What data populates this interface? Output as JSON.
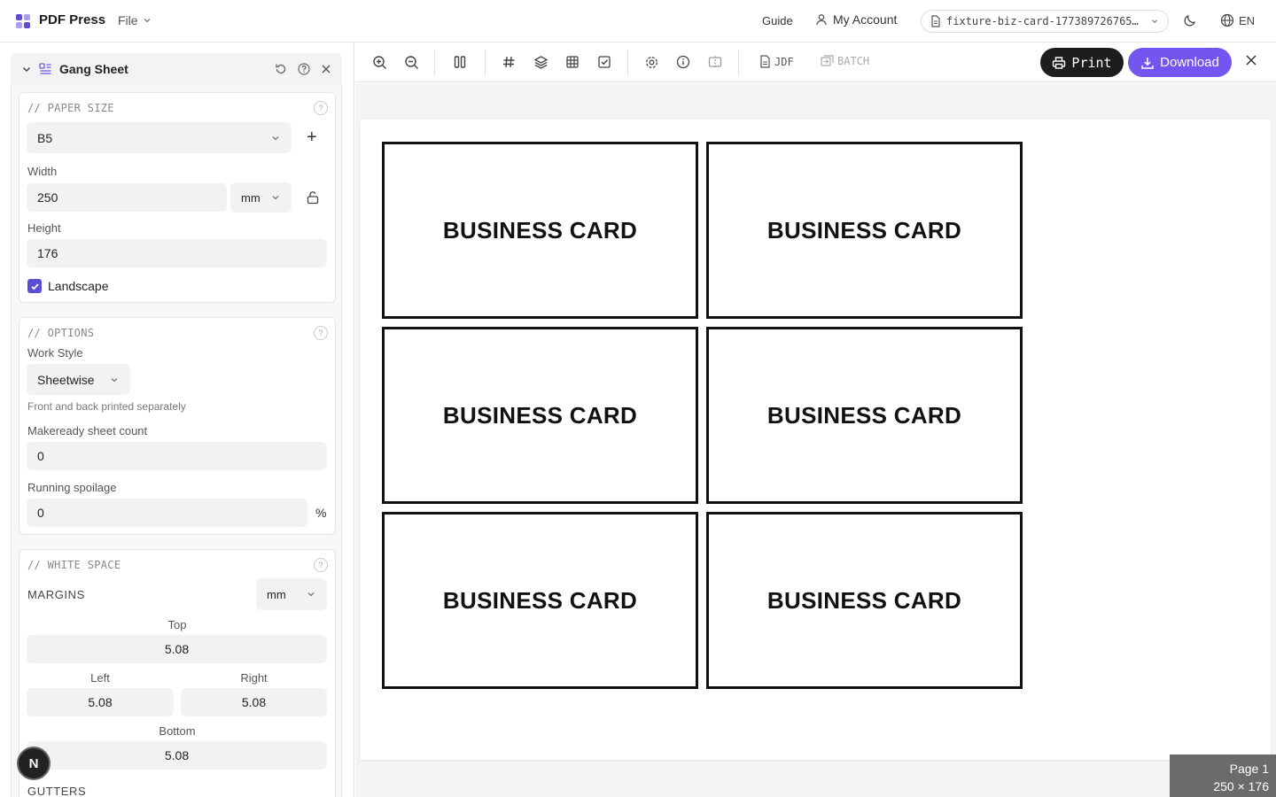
{
  "header": {
    "brand": "PDF Press",
    "file_menu": "File",
    "guide": "Guide",
    "account": "My Account",
    "file_name": "fixture-biz-card-177389726765…",
    "language": "EN",
    "logo_colors": [
      "#5b4dd6",
      "#a89cf3",
      "#a89cf3",
      "#5b4dd6"
    ]
  },
  "sidebar": {
    "panel_title": "Gang Sheet",
    "paper_size": {
      "title": "// PAPER SIZE",
      "preset": "B5",
      "width_label": "Width",
      "width_value": "250",
      "unit": "mm",
      "height_label": "Height",
      "height_value": "176",
      "landscape_label": "Landscape",
      "landscape_checked": true
    },
    "options": {
      "title": "// OPTIONS",
      "work_style_label": "Work Style",
      "work_style_value": "Sheetwise",
      "work_style_note": "Front and back printed separately",
      "makeready_label": "Makeready sheet count",
      "makeready_value": "0",
      "spoilage_label": "Running spoilage",
      "spoilage_value": "0",
      "spoilage_unit": "%"
    },
    "white_space": {
      "title": "// WHITE SPACE",
      "margins_label": "MARGINS",
      "margins_unit": "mm",
      "top_label": "Top",
      "top_value": "5.08",
      "left_label": "Left",
      "left_value": "5.08",
      "right_label": "Right",
      "right_value": "5.08",
      "bottom_label": "Bottom",
      "bottom_value": "5.08",
      "gutters_label": "GUTTERS"
    },
    "badge_letter": "N"
  },
  "toolbar": {
    "jdf_label": "JDF",
    "batch_label": "BATCH",
    "print_label": "Print",
    "download_label": "Download",
    "accent": "#7356f0"
  },
  "canvas": {
    "cards": [
      "BUSINESS CARD",
      "BUSINESS CARD",
      "BUSINESS CARD",
      "BUSINESS CARD",
      "BUSINESS CARD",
      "BUSINESS CARD"
    ],
    "page_label": "Page 1",
    "page_size": "250 × 176"
  }
}
